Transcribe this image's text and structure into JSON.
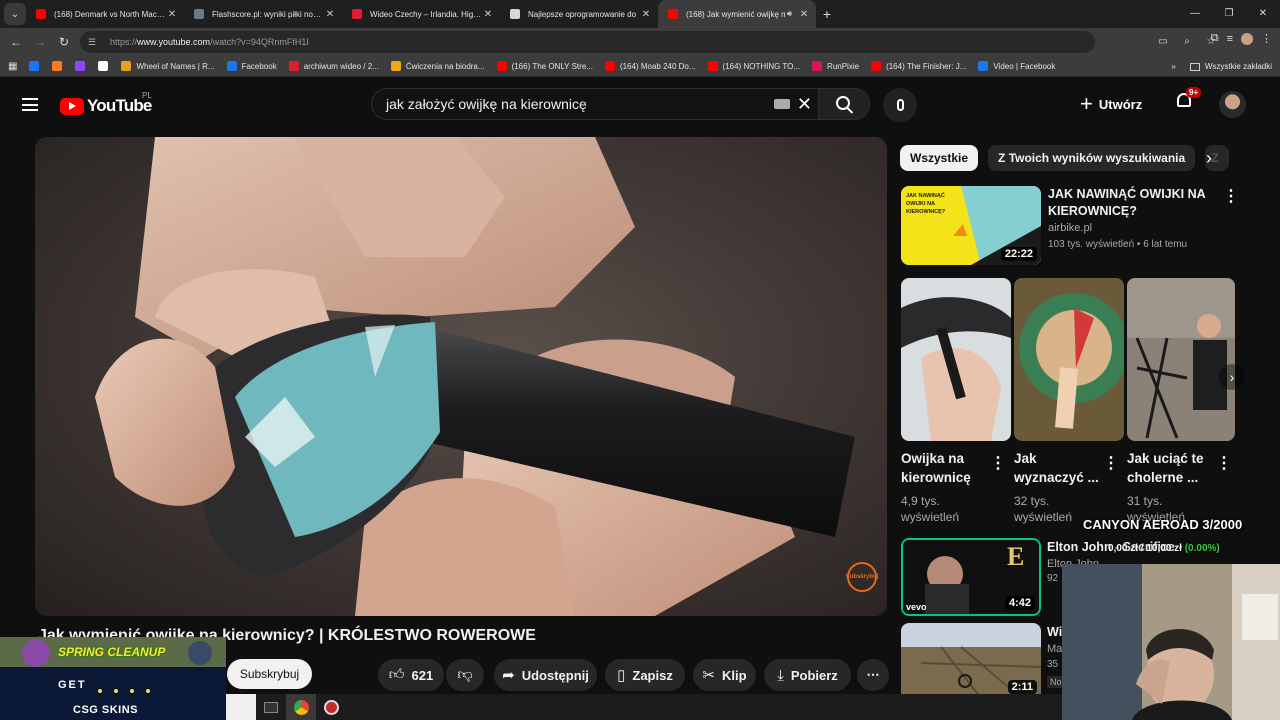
{
  "browser": {
    "tabs": [
      {
        "title": "(168) Denmark vs North Macedonia",
        "fav_color": "#ff0000"
      },
      {
        "title": "Flashscore.pl: wyniki piłki nożnej",
        "fav_color": "#6a7a8a"
      },
      {
        "title": "Wideo Czechy – Irlandia. Highlights",
        "fav_color": "#e01d2f"
      },
      {
        "title": "Najlepsze oprogramowanie do",
        "fav_color": "#d8d8d8"
      },
      {
        "title": "(168) Jak wymienić owijkę n",
        "fav_color": "#ff0000",
        "active": true
      }
    ],
    "new_tab": "+",
    "url_prefix": "https://",
    "url_host": "www.youtube.com",
    "url_path": "/watch?v=94QRnmFfH1I",
    "bookmarks": [
      {
        "label": "",
        "color": "#1877f2"
      },
      {
        "label": "",
        "color": "#ff7a1a"
      },
      {
        "label": "",
        "color": "#9146ff"
      },
      {
        "label": "",
        "color": "#ffffff"
      },
      {
        "label": "Wheel of Names | R...",
        "color": "#e8a021"
      },
      {
        "label": "Facebook",
        "color": "#1877f2"
      },
      {
        "label": "archiwum wideo / 2...",
        "color": "#e01d2f"
      },
      {
        "label": "Ćwiczenia na biodra...",
        "color": "#f2a516"
      },
      {
        "label": "(166) The ONLY Stre...",
        "color": "#ff0000"
      },
      {
        "label": "(164) Moab 240 Do...",
        "color": "#ff0000"
      },
      {
        "label": "(164) NOTHING TO...",
        "color": "#ff0000"
      },
      {
        "label": "RunPixie",
        "color": "#e0115f"
      },
      {
        "label": "(164) The Finisher: J...",
        "color": "#ff0000"
      },
      {
        "label": "Video | Facebook",
        "color": "#1877f2"
      }
    ],
    "bookmarks_all": "Wszystkie zakładki"
  },
  "youtube": {
    "logo_text": "YouTube",
    "region": "PL",
    "search_value": "jak założyć owijkę na kierownicę",
    "create_label": "Utwórz",
    "notif_badge": "9+",
    "video_title": "Jak wymienić owijkę na kierownicy? | KRÓLESTWO ROWEROWE",
    "watermark": "Subskrybuj",
    "subscribe_label": "Subskrybuj",
    "likes": "621",
    "share_label": "Udostępnij",
    "save_label": "Zapisz",
    "clip_label": "Klip",
    "download_label": "Pobierz",
    "chips": [
      "Wszystkie",
      "Z Twoich wyników wyszukiwania",
      "Z"
    ],
    "rec1": {
      "title": "JAK NAWINĄĆ OWIJKI NA KIEROWNICĘ?",
      "channel": "airbike.pl",
      "meta": "103 tys. wyświetleń • 6 lat temu",
      "duration": "22:22",
      "thumb_text": "JAK NAWINĄĆ OWIJKI NA KIEROWNICĘ?"
    },
    "shorts": [
      {
        "title": "Owijka na kierownicę",
        "views": "4,9 tys. wyświetleń"
      },
      {
        "title": "Jak wyznaczyć ...",
        "views": "32 tys. wyświetleń"
      },
      {
        "title": "Jak uciąć te cholerne ...",
        "views": "31 tys. wyświetleń"
      }
    ],
    "rec2": {
      "title": "Elton John - Sacrifice",
      "channel": "Elton John",
      "meta": "92",
      "duration": "4:42",
      "thumb_letter": "E",
      "thumb_brand": "vevo"
    },
    "rec3": {
      "title": "Wi",
      "channel": "Ma",
      "meta": "35",
      "new_badge": "No",
      "duration": "2:11"
    }
  },
  "overlays": {
    "canyon": "CANYON AEROAD 3/2000",
    "price_text": "0,00 zł / 10,00 zł",
    "price_pct": "(0.00%)",
    "promo_spring": "SPRING CLEANUP",
    "promo_get": "GET",
    "promo_brand": "CSG SKINS"
  }
}
